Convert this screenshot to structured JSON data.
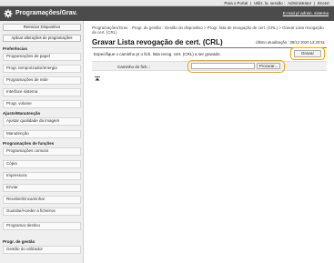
{
  "topbar": {
    "portal": "Para o Portal",
    "user": "Utiliz. la. sessão :",
    "admin": "Administrator",
    "logout": "Encerr."
  },
  "header": {
    "title": "Programações/Grav.",
    "email": "E-mail p/ admin. sistema"
  },
  "sidebar": {
    "restart_label": "Reiniciar Dispositivo",
    "apply_label": "Aplicar alterações de programações",
    "sections": [
      {
        "heading": "Preferências",
        "items": [
          "Programações de papel",
          "Progr. temporizador/energia",
          "Programações de rede",
          "Interface sistema",
          "Progr. volume"
        ]
      },
      {
        "heading": "Ajuste/Manutenção",
        "items": [
          "Ajustar qualidade da imagem",
          "Manutenção"
        ]
      },
      {
        "heading": "Programações de funções",
        "items": [
          "Programações comuns",
          "Cópia",
          "Impressora",
          "Enviar",
          "Receber/Encaminhar",
          "Guardar/Aceder a ficheiros",
          "Programar destino"
        ]
      },
      {
        "heading": "Progr. de gestão",
        "items": [
          "Gestão do utilizador"
        ]
      }
    ]
  },
  "main": {
    "breadcrumb": "Programações/Grav. : Progr. de gestão : Gestão do dispositivo > Progr. lista de revogação de cert. (CRL) > Gravar Lista revogação de cert. (CRL)",
    "title": "Gravar Lista revogação de cert. (CRL)",
    "last_update": "Último atualização : 09/12 2020 12:20:51",
    "instruction": "Especifique o caminho p/ o fich. lista revog. cert. (CRL) a ser gravado.",
    "save_label": "Gravar",
    "file_path_label": "Caminho do fich. :",
    "file_path_value": "",
    "browse_label": "Procurar..."
  },
  "icons": {
    "header": "gear-icon",
    "top": "to-top-icon"
  },
  "colors": {
    "header_bg": "#4b4b4b",
    "highlight": "#f0a500"
  }
}
